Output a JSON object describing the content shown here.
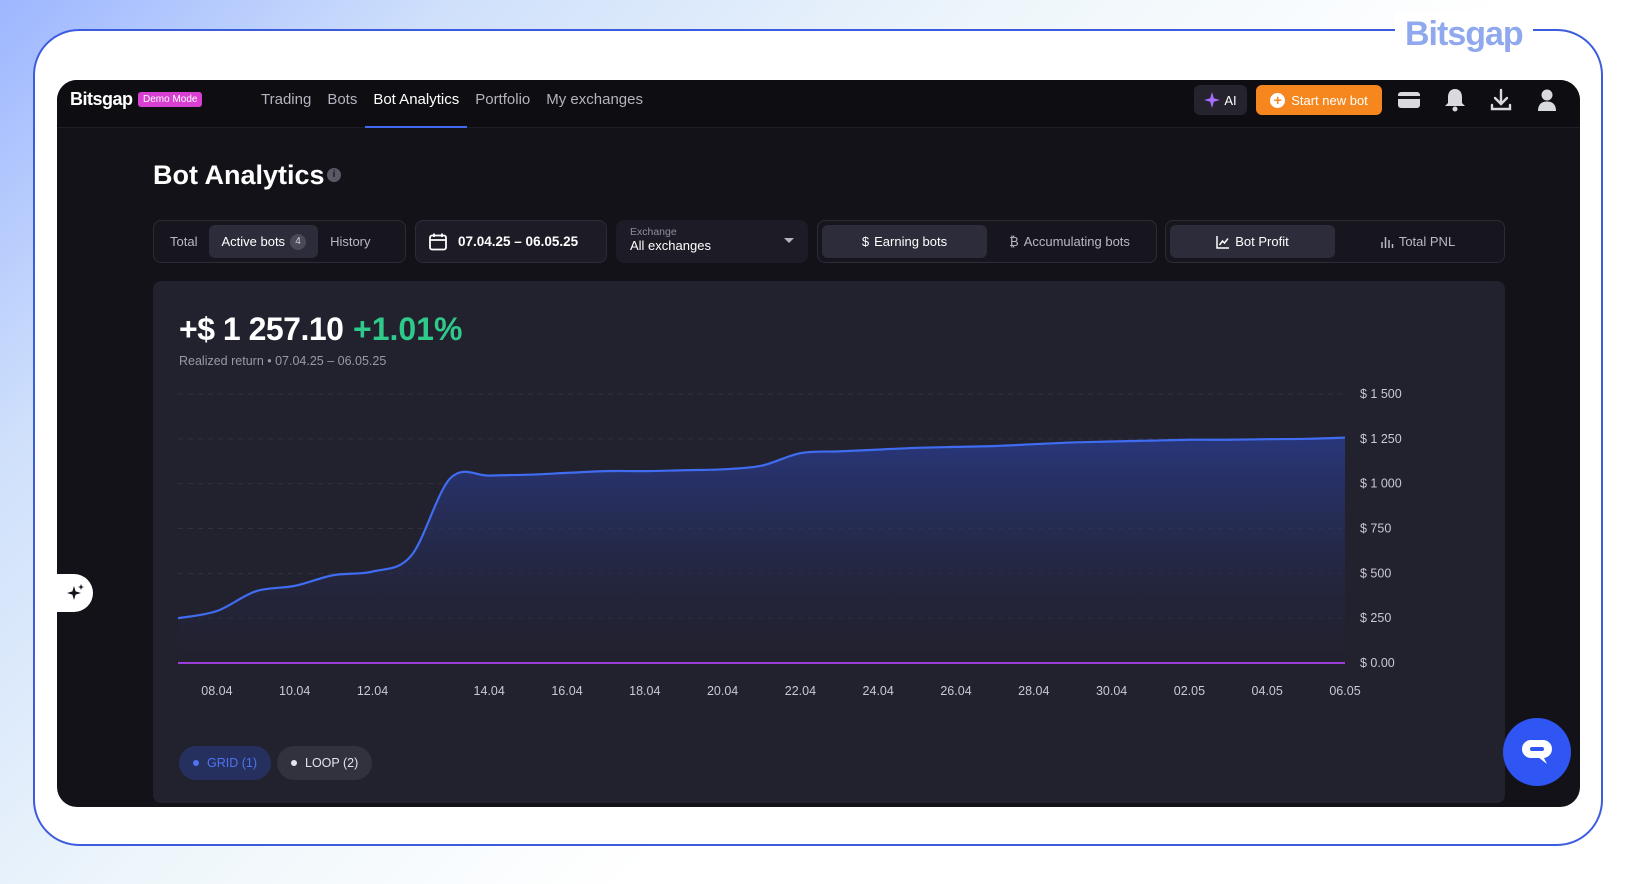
{
  "brand_watermark": "Bitsgap",
  "nav": {
    "logo": "Bitsgap",
    "demo_badge": "Demo Mode",
    "links": [
      "Trading",
      "Bots",
      "Bot Analytics",
      "Portfolio",
      "My exchanges"
    ],
    "active_link": "Bot Analytics",
    "ai_label": "AI",
    "start_bot_label": "Start new bot"
  },
  "page": {
    "title": "Bot Analytics",
    "tabs": {
      "total": "Total",
      "active": "Active bots",
      "active_count": "4",
      "history": "History"
    },
    "date_range": "07.04.25 – 06.05.25",
    "exchange": {
      "label": "Exchange",
      "value": "All exchanges"
    },
    "mode": {
      "earning": "Earning bots",
      "accumulating": "Accumulating bots"
    },
    "view": {
      "bot_profit": "Bot Profit",
      "total_pnl": "Total PNL"
    }
  },
  "summary": {
    "value": "+$ 1 257.10",
    "pct": "+1.01%",
    "subtitle": "Realized return • 07.04.25 – 06.05.25"
  },
  "legend": {
    "grid": "GRID (1)",
    "loop": "LOOP (2)"
  },
  "colors": {
    "accent": "#3f6cf0",
    "positive": "#2fc98a",
    "orange": "#f6871f",
    "loop_line": "#9b3dd6"
  },
  "chart_data": {
    "type": "area",
    "x": [
      "07.04",
      "08.04",
      "09.04",
      "10.04",
      "11.04",
      "12.04",
      "12.5",
      "13.04",
      "14.04",
      "15.04",
      "16.04",
      "17.04",
      "18.04",
      "19.04",
      "20.04",
      "21.04",
      "22.04",
      "23.04",
      "24.04",
      "25.04",
      "26.04",
      "27.04",
      "28.04",
      "29.04",
      "30.04",
      "01.05",
      "02.05",
      "03.05",
      "04.05",
      "05.05",
      "06.05"
    ],
    "x_ticks": [
      "08.04",
      "10.04",
      "12.04",
      "14.04",
      "16.04",
      "18.04",
      "20.04",
      "22.04",
      "24.04",
      "26.04",
      "28.04",
      "30.04",
      "02.05",
      "04.05",
      "06.05"
    ],
    "y_ticks": [
      "$ 0.00",
      "$ 250",
      "$ 500",
      "$ 750",
      "$ 1 000",
      "$ 1 250",
      "$ 1 500"
    ],
    "ylim": [
      0,
      1500
    ],
    "series": [
      {
        "name": "GRID (1)",
        "values": [
          250,
          290,
          400,
          430,
          490,
          510,
          600,
          1030,
          1045,
          1050,
          1060,
          1070,
          1070,
          1075,
          1080,
          1100,
          1170,
          1180,
          1190,
          1200,
          1205,
          1210,
          1220,
          1230,
          1235,
          1240,
          1245,
          1245,
          1248,
          1250,
          1257
        ]
      },
      {
        "name": "LOOP (2)",
        "values": [
          0,
          0,
          0,
          0,
          0,
          0,
          0,
          0,
          0,
          0,
          0,
          0,
          0,
          0,
          0,
          0,
          0,
          0,
          0,
          0,
          0,
          0,
          0,
          0,
          0,
          0,
          0,
          0,
          0,
          0,
          0
        ]
      }
    ],
    "grid": true
  }
}
